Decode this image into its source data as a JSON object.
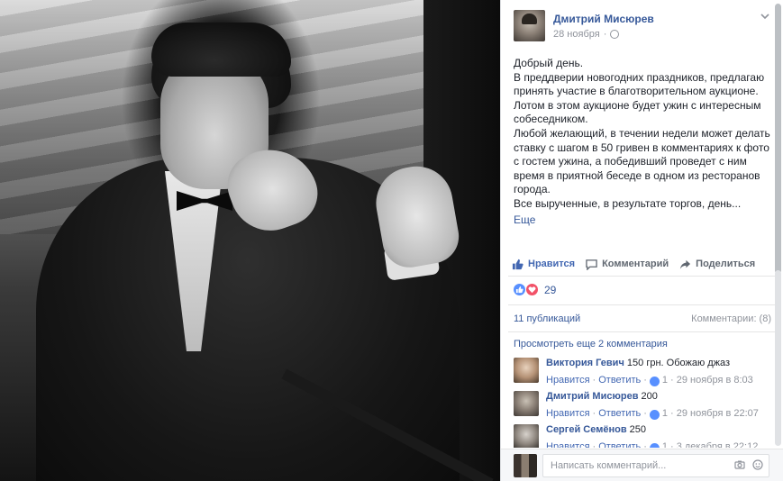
{
  "post": {
    "author": "Дмитрий Мисюрев",
    "date": "28 ноября",
    "privacy_icon": "globe-icon",
    "options_icon": "chevron-down-icon",
    "paragraphs": [
      "Добрый день.",
      "В преддверии новогодних праздников, предлагаю принять участие в благотворительном аукционе.",
      "Лотом в этом аукционе будет ужин с интересным собеседником.",
      "Любой желающий, в течении недели может делать ставку с шагом в 50 гривен в комментариях к фото с гостем ужина, а победивший проведет с ним время в приятной беседе в одном из ресторанов города.",
      "Все вырученные, в результате торгов, день..."
    ],
    "more_label": "Еще"
  },
  "actions": {
    "like": "Нравится",
    "comment": "Комментарий",
    "share": "Поделиться"
  },
  "reactions": {
    "count": "29"
  },
  "stats": {
    "shares": "11 публикаций",
    "comments": "Комментарии: (8)"
  },
  "view_more": "Просмотреть еще 2 комментария",
  "comments": [
    {
      "name": "Виктория Гевич",
      "text": "150 грн. Обожаю джаз",
      "like": "Нравится",
      "reply": "Ответить",
      "likes": "1",
      "time": "29 ноября в 8:03"
    },
    {
      "name": "Дмитрий Мисюрев",
      "text": "200",
      "like": "Нравится",
      "reply": "Ответить",
      "likes": "1",
      "time": "29 ноября в 22:07"
    },
    {
      "name": "Сергей Семёнов",
      "text": "250",
      "like": "Нравится",
      "reply": "Ответить",
      "likes": "1",
      "time": "3 декабря в 22:12"
    }
  ],
  "composer": {
    "placeholder": "Написать комментарий..."
  },
  "colors": {
    "link": "#365899",
    "accent": "#4267b2",
    "muted": "#90949c"
  }
}
